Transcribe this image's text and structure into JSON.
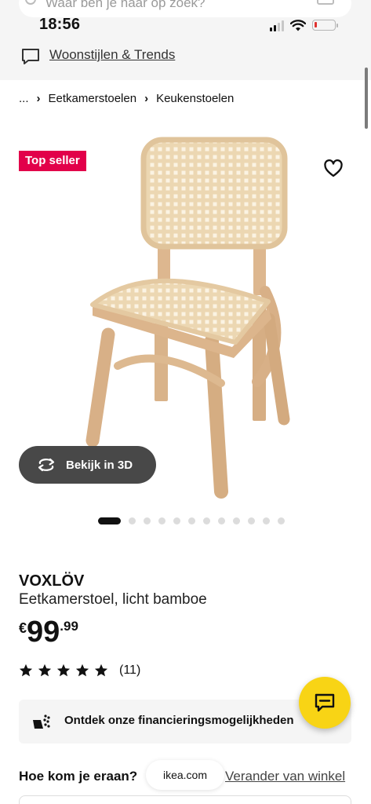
{
  "search": {
    "placeholder": "Waar ben je naar op zoek?"
  },
  "status_bar": {
    "time": "18:56",
    "battery_level": 0.1,
    "signal_bars": 2
  },
  "promo": {
    "link": "Woonstijlen & Trends",
    "icon": "chat-bubble-icon"
  },
  "breadcrumb": {
    "ellipsis": "...",
    "items": [
      "Eetkamerstoelen",
      "Keukenstoelen"
    ],
    "separator": "›"
  },
  "product": {
    "badge": "Top seller",
    "name": "VOXLÖV",
    "description": "Eetkamerstoel, licht bamboe",
    "price": {
      "currency": "€",
      "integer": "99",
      "decimal": ".99"
    },
    "rating": {
      "stars": 5,
      "max": 5,
      "count": "(11)"
    },
    "view3d_label": "Bekijk in 3D"
  },
  "gallery": {
    "total": 12,
    "active_index": 0
  },
  "finance": {
    "label": "Ontdek onze financieringsmogelijkheden"
  },
  "delivery": {
    "label": "Hoe kom je eraan?",
    "change_store": "Verander van winkel"
  },
  "browser": {
    "url": "ikea.com"
  },
  "colors": {
    "badge": "#e2004a",
    "chat_button": "#f8d415",
    "battery_low": "#e0322f"
  }
}
